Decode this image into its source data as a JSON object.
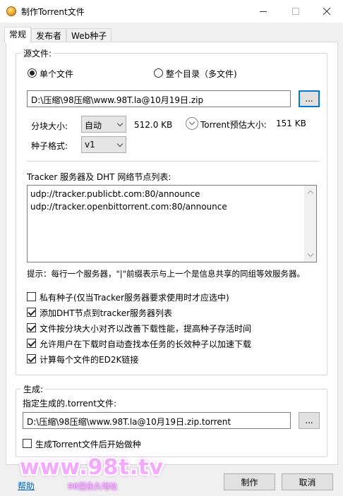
{
  "window": {
    "title": "制作Torrent文件"
  },
  "tabs": [
    {
      "label": "常规",
      "active": true
    },
    {
      "label": "发布者",
      "active": false
    },
    {
      "label": "Web种子",
      "active": false
    }
  ],
  "source": {
    "group_title": "源文件:",
    "radio_single": "单个文件",
    "radio_dir": "整个目录（多文件)",
    "selected": "single",
    "path": "D:\\压缩\\98压缩\\www.98T.la@10月19日.zip",
    "browse_label": "...",
    "piece_size_label": "分块大小:",
    "piece_size_value": "自动",
    "piece_size_text": "512.0 KB",
    "estimate_label": "Torrent预估大小:",
    "estimate_value": "151 KB",
    "format_label": "种子格式:",
    "format_value": "v1"
  },
  "tracker": {
    "label": "Tracker 服务器及 DHT 网络节点列表:",
    "lines": [
      "udp://tracker.publicbt.com:80/announce",
      "udp://tracker.openbittorrent.com:80/announce"
    ],
    "hint": "提示：每行一个服务器，\"|\"前缀表示与上一个是信息共享的同组等效服务器。"
  },
  "options": [
    {
      "label": "私有种子(仅当Tracker服务器要求使用时才应选中)",
      "checked": false
    },
    {
      "label": "添加DHT节点到tracker服务器列表",
      "checked": true
    },
    {
      "label": "文件按分块大小对齐以改善下载性能，提高种子存活时间",
      "checked": true
    },
    {
      "label": "允许用户在下载时自动查找本任务的长效种子以加速下载",
      "checked": true
    },
    {
      "label": "计算每个文件的ED2K链接",
      "checked": true
    }
  ],
  "output": {
    "group_title": "生成:",
    "label": "指定生成的.torrent文件:",
    "path": "D:\\压缩\\98压缩\\www.98T.la@10月19日.zip.torrent",
    "browse_label": "...",
    "seed_label": "生成Torrent文件后开始做种",
    "seed_checked": false
  },
  "footer": {
    "help": "帮助",
    "create": "制作",
    "cancel": "取消",
    "watermark": "www.98t.tv",
    "watermark_sub": "98堂永久地址"
  }
}
